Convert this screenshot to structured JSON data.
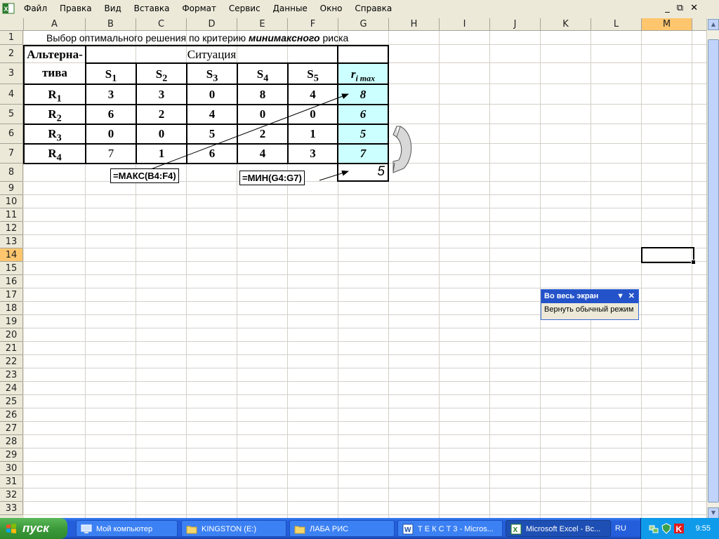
{
  "menubar": {
    "items": [
      "Файл",
      "Правка",
      "Вид",
      "Вставка",
      "Формат",
      "Сервис",
      "Данные",
      "Окно",
      "Справка"
    ],
    "window_buttons": [
      "_",
      "⧉",
      "✕"
    ]
  },
  "columns": [
    "A",
    "B",
    "C",
    "D",
    "E",
    "F",
    "G",
    "H",
    "I",
    "J",
    "K",
    "L",
    "M"
  ],
  "active_column": "M",
  "rows": [
    "1",
    "2",
    "3",
    "4",
    "5",
    "6",
    "7",
    "8",
    "9",
    "10",
    "11",
    "12",
    "13",
    "14",
    "15",
    "16",
    "17",
    "18",
    "19",
    "20",
    "21",
    "22",
    "23",
    "24",
    "25",
    "26",
    "27",
    "28",
    "29",
    "30",
    "31",
    "32",
    "33"
  ],
  "active_row": "14",
  "sheet": {
    "title_pre": "Выбор оптимального решения по критерию ",
    "title_bold": "минимаксного",
    "title_post": " риска",
    "alt_header_1": "Альтерна-",
    "alt_header_2": "тива",
    "situation_header": "Ситуация",
    "s_headers": [
      {
        "base": "S",
        "sub": "1"
      },
      {
        "base": "S",
        "sub": "2"
      },
      {
        "base": "S",
        "sub": "3"
      },
      {
        "base": "S",
        "sub": "4"
      },
      {
        "base": "S",
        "sub": "5"
      }
    ],
    "r_max_header": {
      "base": "r",
      "sub": "i max"
    },
    "alternatives": [
      {
        "base": "R",
        "sub": "1",
        "values": [
          "3",
          "3",
          "0",
          "8",
          "4"
        ],
        "rmax": "8"
      },
      {
        "base": "R",
        "sub": "2",
        "values": [
          "6",
          "2",
          "4",
          "0",
          "0"
        ],
        "rmax": "6"
      },
      {
        "base": "R",
        "sub": "3",
        "values": [
          "0",
          "0",
          "5",
          "2",
          "1"
        ],
        "rmax": "5"
      },
      {
        "base": "R",
        "sub": "4",
        "values": [
          "7",
          "1",
          "6",
          "4",
          "3"
        ],
        "rmax": "7"
      }
    ],
    "min_result": "5",
    "formula_max": "=МАКС(B4:F4)",
    "formula_min": "=МИН(G4:G7)"
  },
  "fullscreen_toolbar": {
    "title": "Во весь экран",
    "button": "Вернуть обычный режим"
  },
  "taskbar": {
    "start": "пуск",
    "tasks": [
      {
        "label": "Мой компьютер",
        "icon": "computer-icon"
      },
      {
        "label": "KINGSTON (E:)",
        "icon": "folder-icon"
      },
      {
        "label": "ЛАБА РИС",
        "icon": "folder-icon"
      },
      {
        "label": "Т Е К С Т 3 - Micros...",
        "icon": "word-icon"
      },
      {
        "label": "Microsoft Excel - Вс...",
        "icon": "excel-icon",
        "active": true
      }
    ],
    "lang": "RU",
    "clock": "9:55"
  }
}
